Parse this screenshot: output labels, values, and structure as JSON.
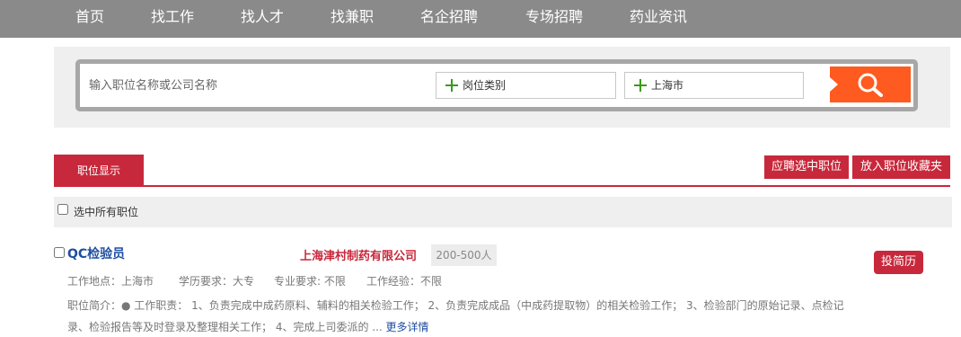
{
  "nav": {
    "items": [
      {
        "label": "首页"
      },
      {
        "label": "找工作"
      },
      {
        "label": "找人才"
      },
      {
        "label": "找兼职"
      },
      {
        "label": "名企招聘"
      },
      {
        "label": "专场招聘"
      },
      {
        "label": "药业资讯"
      }
    ]
  },
  "search": {
    "placeholder": "输入职位名称或公司名称",
    "category_label": "岗位类别",
    "location_label": "上海市",
    "button_icon": "magnifier-icon",
    "select_icon": "plus-icon"
  },
  "tabs": {
    "active_label": "职位显示",
    "apply_selected_label": "应聘选中职位",
    "favorite_label": "放入职位收藏夹"
  },
  "list": {
    "select_all_label": "选中所有职位",
    "jobs": [
      {
        "title": "QC检验员",
        "company": "上海津村制药有限公司",
        "company_size": "200-500人",
        "location": "工作地点：上海市",
        "education": "学历要求：大专",
        "major": "专业要求: 不限",
        "experience": "工作经验：不限",
        "summary": "职位简介：● 工作职责： 1、负责完成中成药原料、辅料的相关检验工作； 2、负责完成成品（中成药提取物）的相关检验工作； 3、检验部门的原始记录、点检记录、检验报告等及时登录及整理相关工作； 4、完成上司委派的 ...",
        "more_label": "更多详情",
        "apply_label": "投简历"
      }
    ]
  },
  "colors": {
    "nav_bg": "#8a8a8a",
    "accent_red": "#c8283b",
    "search_orange": "#ff5a1f",
    "plus_green": "#3a9a1c",
    "link_blue": "#1f4ea1"
  }
}
